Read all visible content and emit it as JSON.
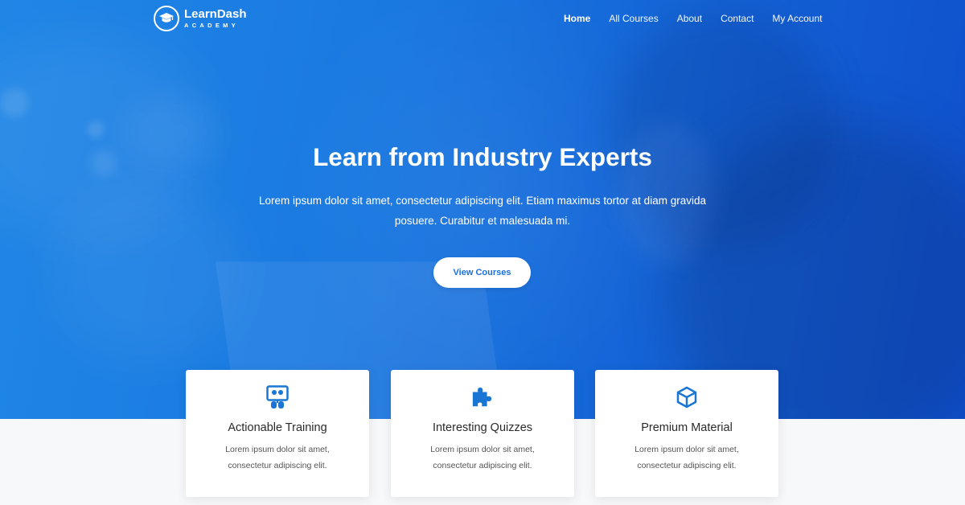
{
  "brand": {
    "name": "LearnDash",
    "tagline": "ACADEMY"
  },
  "nav": {
    "items": [
      {
        "label": "Home",
        "active": true
      },
      {
        "label": "All Courses",
        "active": false
      },
      {
        "label": "About",
        "active": false
      },
      {
        "label": "Contact",
        "active": false
      },
      {
        "label": "My Account",
        "active": false
      }
    ]
  },
  "hero": {
    "title": "Learn from Industry Experts",
    "subtitle_line1": "Lorem ipsum dolor sit amet, consectetur adipiscing elit. Etiam maximus tortor at diam gravida",
    "subtitle_line2": "posuere. Curabitur et malesuada mi.",
    "cta_label": "View Courses"
  },
  "features": [
    {
      "icon": "training-icon",
      "title": "Actionable Training",
      "desc_line1": "Lorem ipsum dolor sit amet,",
      "desc_line2": "consectetur adipiscing elit."
    },
    {
      "icon": "puzzle-icon",
      "title": "Interesting Quizzes",
      "desc_line1": "Lorem ipsum dolor sit amet,",
      "desc_line2": "consectetur adipiscing elit."
    },
    {
      "icon": "cube-icon",
      "title": "Premium Material",
      "desc_line1": "Lorem ipsum dolor sit amet,",
      "desc_line2": "consectetur adipiscing elit."
    }
  ],
  "colors": {
    "primary": "#1a78e0",
    "primary_dark": "#0f4fcb",
    "icon_blue": "#1976d2",
    "page_bg": "#f7f8fa"
  }
}
